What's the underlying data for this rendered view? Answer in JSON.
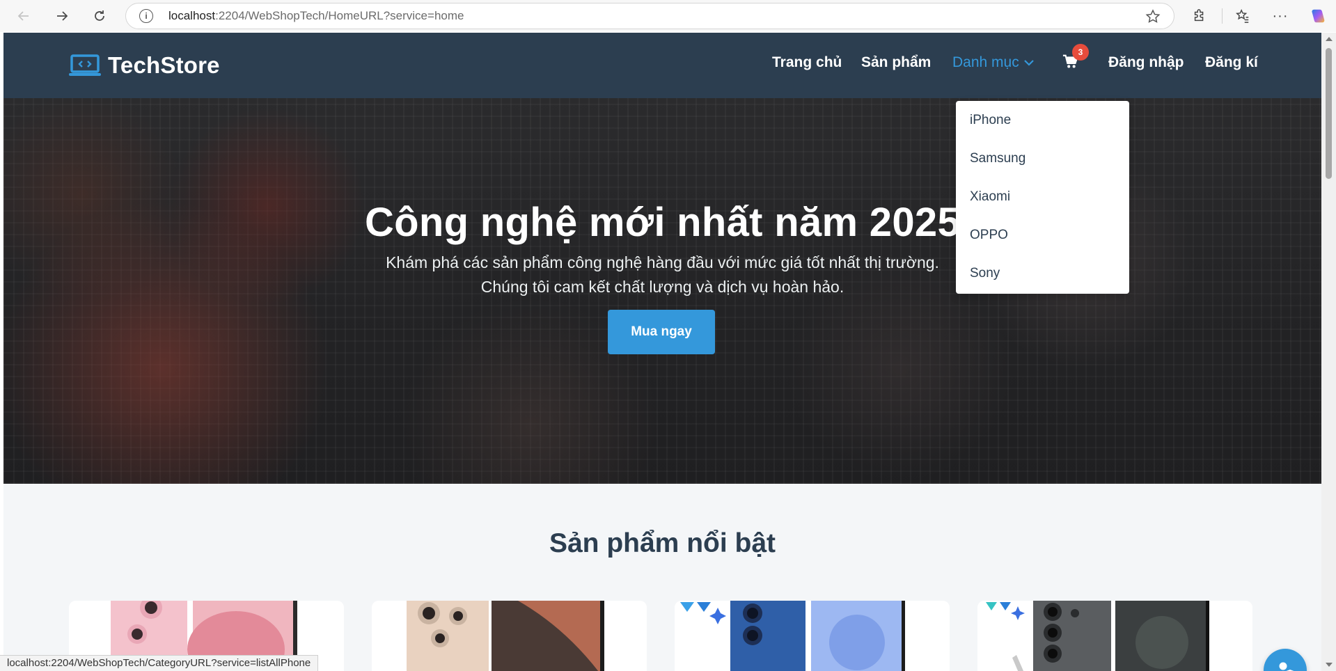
{
  "browser": {
    "url_host": "localhost",
    "url_rest": ":2204/WebShopTech/HomeURL?service=home",
    "status_url": "localhost:2204/WebShopTech/CategoryURL?service=listAllPhone"
  },
  "header": {
    "logo_text": "TechStore",
    "nav": {
      "home": "Trang chủ",
      "products": "Sản phẩm",
      "categories": "Danh mục",
      "login": "Đăng nhập",
      "register": "Đăng kí"
    },
    "cart_count": "3"
  },
  "dropdown": {
    "items": [
      "iPhone",
      "Samsung",
      "Xiaomi",
      "OPPO",
      "Sony"
    ]
  },
  "hero": {
    "title": "Công nghệ mới nhất năm 2025",
    "subtitle_line1": "Khám phá các sản phẩm công nghệ hàng đầu với mức giá tốt nhất thị trường.",
    "subtitle_line2": "Chúng tôi cam kết chất lượng và dịch vụ hoàn hảo.",
    "cta": "Mua ngay"
  },
  "featured": {
    "title": "Sản phẩm nổi bật",
    "products": [
      {
        "image": "pink-iphone"
      },
      {
        "image": "titanium-iphone-pro"
      },
      {
        "image": "blue-galaxy-phone"
      },
      {
        "image": "gray-galaxy-ultra"
      }
    ]
  },
  "colors": {
    "header_bg": "#2c3e50",
    "accent": "#3498db",
    "badge": "#e74c3c"
  }
}
